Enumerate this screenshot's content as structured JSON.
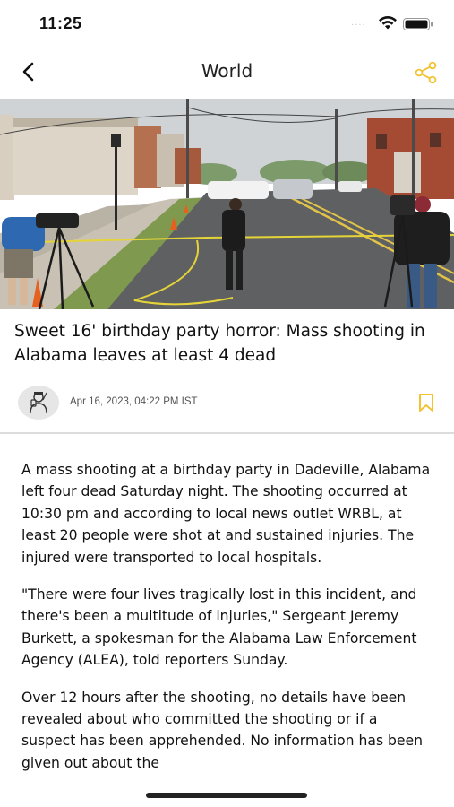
{
  "status_bar": {
    "time": "11:25",
    "signal_dots": "....",
    "icons": [
      "wifi-icon",
      "battery-icon"
    ]
  },
  "nav": {
    "title": "World",
    "back_icon": "chevron-left-icon",
    "share_icon": "share-icon",
    "accent_color": "#F2C230"
  },
  "article": {
    "hero_image": "crime-scene-street-photo",
    "headline": "Sweet 16' birthday party horror: Mass shooting in Alabama leaves at least 4 dead",
    "author_avatar_icon": "reporter-avatar-icon",
    "date": "Apr 16, 2023, 04:22 PM IST",
    "bookmark_icon": "bookmark-icon",
    "paragraphs": [
      "A mass shooting at a birthday party in Dadeville, Alabama left four dead Saturday night. The shooting occurred at 10:30 pm and according to local news outlet WRBL, at least 20 people were shot at and sustained injuries. The injured were transported to local hospitals.",
      "\"There were four lives tragically lost in this incident, and there's been a multitude of injuries,\" Sergeant Jeremy Burkett, a spokesman for the Alabama Law Enforcement Agency (ALEA), told reporters Sunday.",
      "Over 12 hours after the shooting, no details have been revealed about who committed the shooting or if a suspect has been apprehended. No information has been given out about the"
    ]
  }
}
